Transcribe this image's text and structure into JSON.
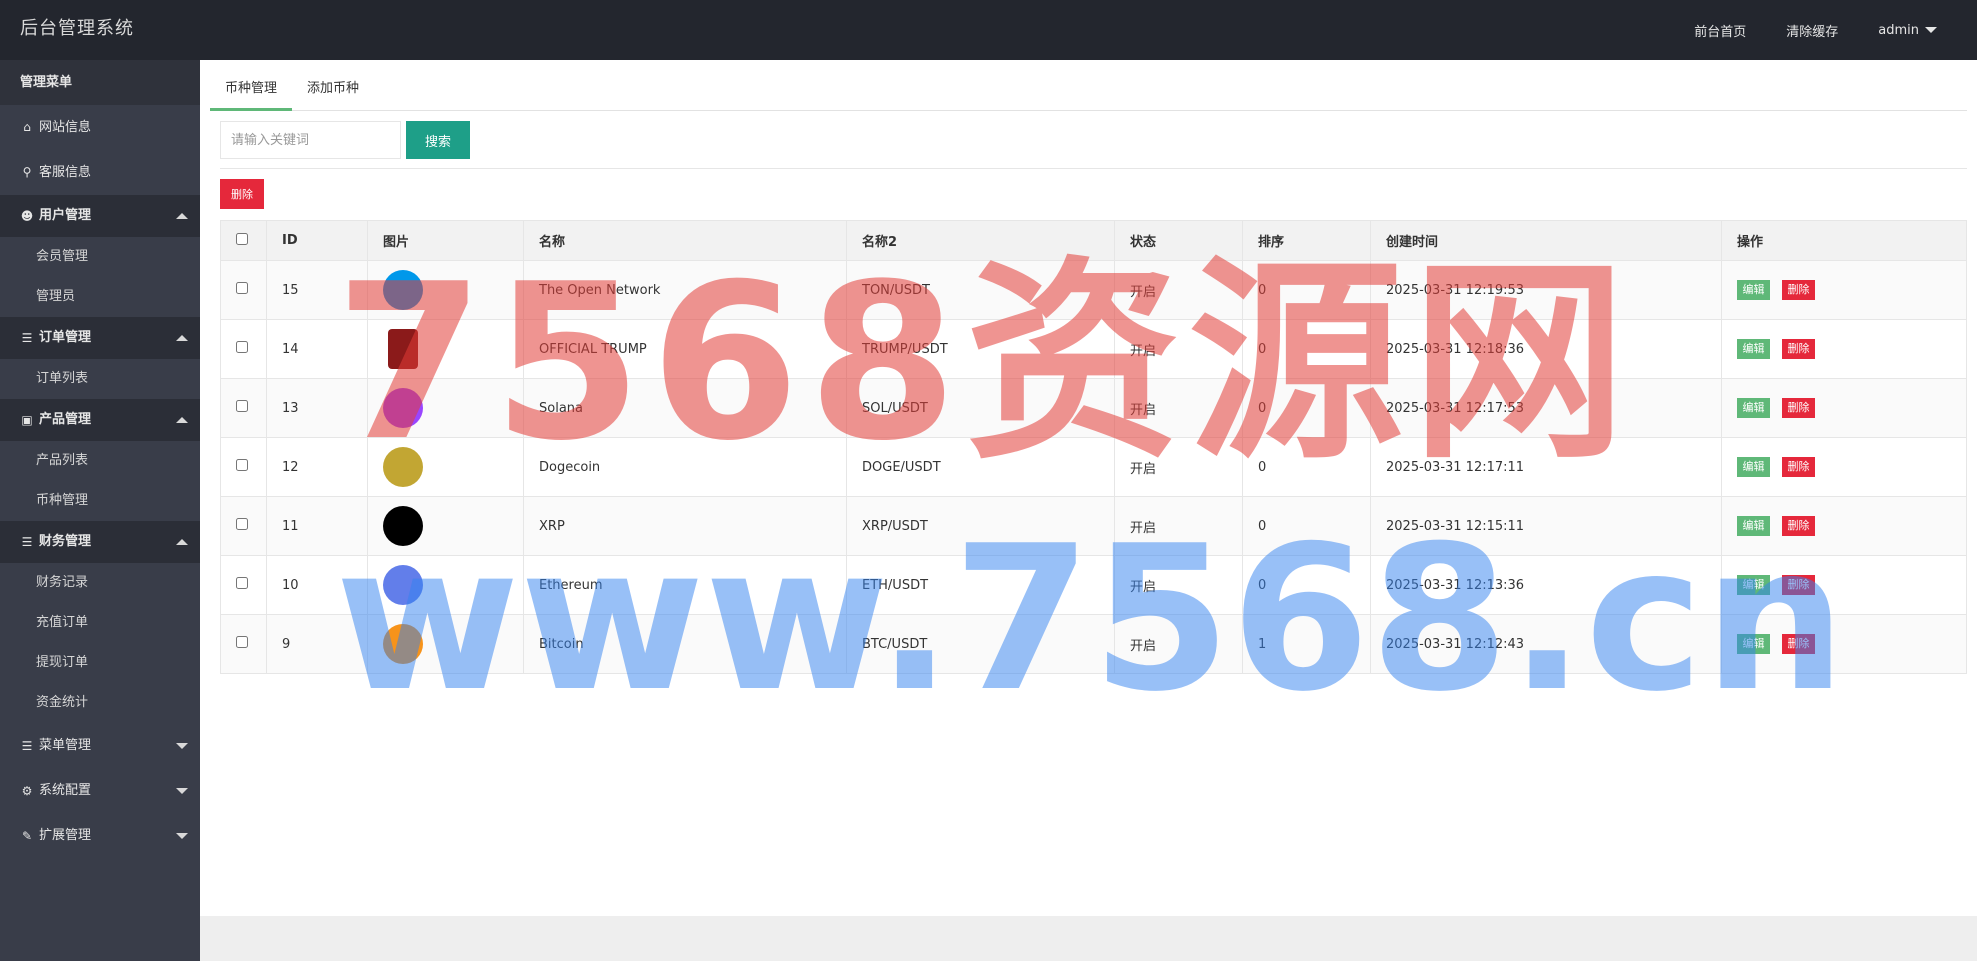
{
  "header": {
    "brand": "后台管理系统",
    "nav": [
      "前台首页",
      "清除缓存"
    ],
    "user": "admin"
  },
  "sidebar": {
    "title": "管理菜单",
    "items": [
      {
        "label": "网站信息",
        "icon": "home-icon"
      },
      {
        "label": "客服信息",
        "icon": "link-icon"
      }
    ],
    "groups": [
      {
        "label": "用户管理",
        "icon": "users-icon",
        "open": true,
        "subs": [
          "会员管理",
          "管理员"
        ]
      },
      {
        "label": "订单管理",
        "icon": "list-icon",
        "open": true,
        "subs": [
          "订单列表"
        ]
      },
      {
        "label": "产品管理",
        "icon": "box-icon",
        "open": true,
        "subs": [
          "产品列表",
          "币种管理"
        ]
      },
      {
        "label": "财务管理",
        "icon": "list-icon",
        "open": true,
        "subs": [
          "财务记录",
          "充值订单",
          "提现订单",
          "资金统计"
        ]
      },
      {
        "label": "菜单管理",
        "icon": "list-icon",
        "open": false,
        "subs": []
      },
      {
        "label": "系统配置",
        "icon": "gears-icon",
        "open": false,
        "subs": []
      },
      {
        "label": "扩展管理",
        "icon": "wrench-icon",
        "open": false,
        "subs": []
      }
    ]
  },
  "tabs": [
    {
      "label": "币种管理",
      "active": true
    },
    {
      "label": "添加币种",
      "active": false
    }
  ],
  "search": {
    "placeholder": "请输入关键词",
    "button": "搜索"
  },
  "delete_button": "删除",
  "table": {
    "headers": [
      "ID",
      "图片",
      "名称",
      "名称2",
      "状态",
      "排序",
      "创建时间",
      "操作"
    ],
    "edit_label": "编辑",
    "delete_label": "删除",
    "rows": [
      {
        "id": "15",
        "name": "The Open Network",
        "name2": "TON/USDT",
        "status": "开启",
        "sort": "0",
        "created": "2025-03-31 12:19:53",
        "icon_color": "#0098ea"
      },
      {
        "id": "14",
        "name": "OFFICIAL TRUMP",
        "name2": "TRUMP/USDT",
        "status": "开启",
        "sort": "0",
        "created": "2025-03-31 12:18:36",
        "icon_color": "#8b1a1a"
      },
      {
        "id": "13",
        "name": "Solana",
        "name2": "SOL/USDT",
        "status": "开启",
        "sort": "0",
        "created": "2025-03-31 12:17:53",
        "icon_color": "#9945ff"
      },
      {
        "id": "12",
        "name": "Dogecoin",
        "name2": "DOGE/USDT",
        "status": "开启",
        "sort": "0",
        "created": "2025-03-31 12:17:11",
        "icon_color": "#c2a633"
      },
      {
        "id": "11",
        "name": "XRP",
        "name2": "XRP/USDT",
        "status": "开启",
        "sort": "0",
        "created": "2025-03-31 12:15:11",
        "icon_color": "#000000"
      },
      {
        "id": "10",
        "name": "Ethereum",
        "name2": "ETH/USDT",
        "status": "开启",
        "sort": "0",
        "created": "2025-03-31 12:13:36",
        "icon_color": "#627eea"
      },
      {
        "id": "9",
        "name": "Bitcoin",
        "name2": "BTC/USDT",
        "status": "开启",
        "sort": "1",
        "created": "2025-03-31 12:12:43",
        "icon_color": "#f7931a"
      }
    ]
  },
  "watermark": {
    "line1": "7568资源网",
    "line2": "www.7568.cn"
  }
}
